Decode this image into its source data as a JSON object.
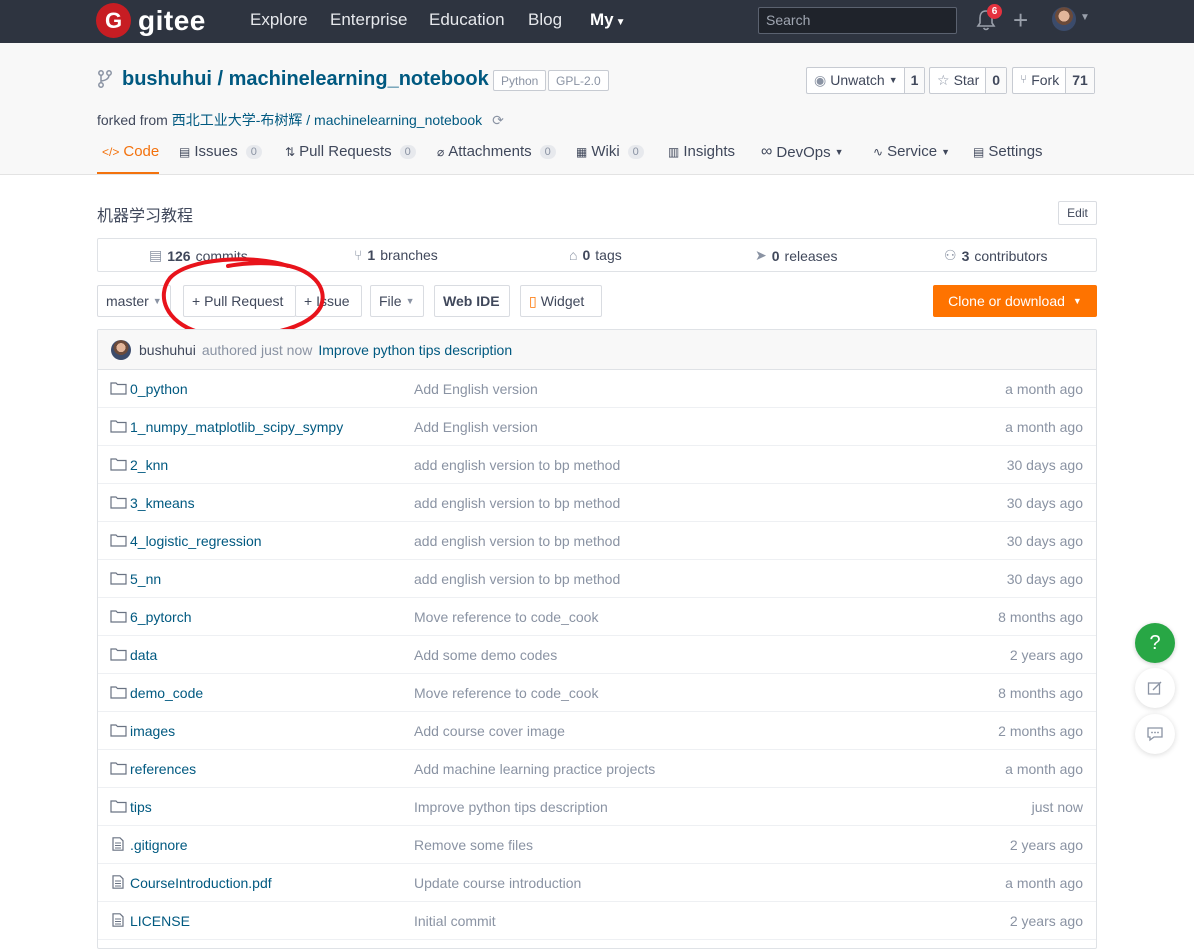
{
  "nav": {
    "logo_badge": "G",
    "logo_text": "gitee",
    "links": [
      "Explore",
      "Enterprise",
      "Education",
      "Blog"
    ],
    "my": "My",
    "search_placeholder": "Search",
    "notifications": "6"
  },
  "repo": {
    "title": "bushuhui / machinelearning_notebook",
    "language": "Python",
    "license": "GPL-2.0",
    "unwatch_label": "Unwatch",
    "watch_count": "1",
    "star_label": "Star",
    "star_count": "0",
    "fork_label": "Fork",
    "fork_count": "71",
    "forked_from_prefix": "forked from",
    "forked_from_owner": "西北工业大学-布树辉",
    "forked_from_sep": "/",
    "forked_from_repo": "machinelearning_notebook",
    "description": "机器学习教程",
    "edit_label": "Edit"
  },
  "tabs": [
    {
      "label": "Code",
      "icon": "</>",
      "count": null
    },
    {
      "label": "Issues",
      "count": "0"
    },
    {
      "label": "Pull Requests",
      "count": "0"
    },
    {
      "label": "Attachments",
      "count": "0"
    },
    {
      "label": "Wiki",
      "count": "0"
    },
    {
      "label": "Insights",
      "count": null
    },
    {
      "label": "DevOps",
      "count": null
    },
    {
      "label": "Service",
      "count": null
    },
    {
      "label": "Settings",
      "count": null
    }
  ],
  "stats": {
    "commits_count": "126",
    "commits_label": "commits",
    "branches_count": "1",
    "branches_label": "branches",
    "tags_count": "0",
    "tags_label": "tags",
    "releases_count": "0",
    "releases_label": "releases",
    "contributors_count": "3",
    "contributors_label": "contributors"
  },
  "toolbar": {
    "branch": "master",
    "pull_request": "+ Pull Request",
    "issue": "+ Issue",
    "file": "File",
    "web_ide": "Web IDE",
    "widget": "Widget",
    "clone": "Clone or download"
  },
  "last_commit": {
    "author": "bushuhui",
    "meta": "authored just now",
    "message": "Improve python tips description"
  },
  "files": [
    {
      "name": "0_python",
      "type": "folder",
      "message": "Add English version",
      "time": "a month ago"
    },
    {
      "name": "1_numpy_matplotlib_scipy_sympy",
      "type": "folder",
      "message": "Add English version",
      "time": "a month ago"
    },
    {
      "name": "2_knn",
      "type": "folder",
      "message": "add english version to bp method",
      "time": "30 days ago"
    },
    {
      "name": "3_kmeans",
      "type": "folder",
      "message": "add english version to bp method",
      "time": "30 days ago"
    },
    {
      "name": "4_logistic_regression",
      "type": "folder",
      "message": "add english version to bp method",
      "time": "30 days ago"
    },
    {
      "name": "5_nn",
      "type": "folder",
      "message": "add english version to bp method",
      "time": "30 days ago"
    },
    {
      "name": "6_pytorch",
      "type": "folder",
      "message": "Move reference to code_cook",
      "time": "8 months ago"
    },
    {
      "name": "data",
      "type": "folder",
      "message": "Add some demo codes",
      "time": "2 years ago"
    },
    {
      "name": "demo_code",
      "type": "folder",
      "message": "Move reference to code_cook",
      "time": "8 months ago"
    },
    {
      "name": "images",
      "type": "folder",
      "message": "Add course cover image",
      "time": "2 months ago"
    },
    {
      "name": "references",
      "type": "folder",
      "message": "Add machine learning practice projects",
      "time": "a month ago"
    },
    {
      "name": "tips",
      "type": "folder",
      "message": "Improve python tips description",
      "time": "just now"
    },
    {
      "name": ".gitignore",
      "type": "file",
      "message": "Remove some files",
      "time": "2 years ago"
    },
    {
      "name": "CourseIntroduction.pdf",
      "type": "file",
      "message": "Update course introduction",
      "time": "a month ago"
    },
    {
      "name": "LICENSE",
      "type": "file",
      "message": "Initial commit",
      "time": "2 years ago"
    }
  ],
  "float": {
    "help": "?"
  },
  "colors": {
    "accent": "#fe7300",
    "link": "#005980",
    "nav_bg": "#2e3440",
    "annotation": "#e8131b"
  }
}
